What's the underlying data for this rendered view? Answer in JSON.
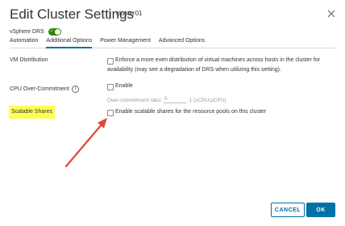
{
  "dialog": {
    "title": "Edit Cluster Settings",
    "subtitle": "cluster01"
  },
  "drs": {
    "label": "vSphere DRS",
    "enabled": true,
    "toggle_check": "✓",
    "color": "#2f8400"
  },
  "tabs": [
    {
      "label": "Automation",
      "active": false
    },
    {
      "label": "Additional Options",
      "active": true
    },
    {
      "label": "Power Management",
      "active": false
    },
    {
      "label": "Advanced Options",
      "active": false
    }
  ],
  "settings": {
    "vm_distribution": {
      "label": "VM Distribution",
      "text_line1": "Enforce a more even distribution of virtual machines across hosts in the cluster for",
      "text_line2": "availability (may see a degradation of DRS when utilizing this setting).",
      "checked": false
    },
    "cpu_overcommit": {
      "label": "CPU Over-Commitment",
      "info_icon": "i",
      "enable_label": "Enable",
      "checked": false,
      "ratio_label": "Over-commitment ratio:",
      "ratio_value": "0",
      "ratio_unit": ":1 (vCPU:pCPU)"
    },
    "scalable_shares": {
      "label": "Scalable Shares",
      "text": "Enable scalable shares for the resource pools on this cluster",
      "checked": false,
      "highlight_color": "#ffff55"
    }
  },
  "annotation": {
    "arrow_color": "#e0463a"
  },
  "footer": {
    "cancel_label": "CANCEL",
    "ok_label": "OK",
    "accent": "#0072a3"
  }
}
